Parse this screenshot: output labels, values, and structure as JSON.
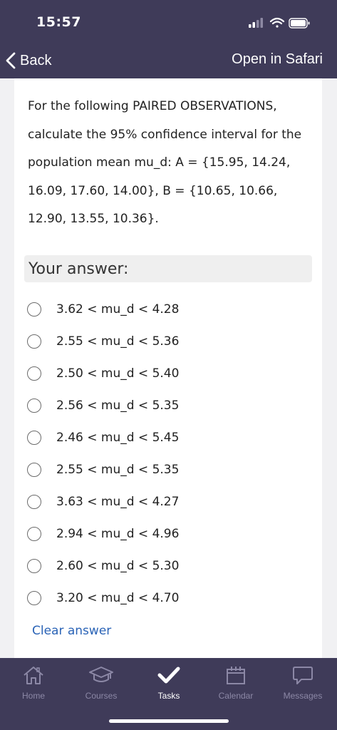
{
  "status_bar": {
    "time": "15:57"
  },
  "nav": {
    "back_label": "Back",
    "open_label": "Open in Safari"
  },
  "question": {
    "text": "For the following PAIRED OBSERVATIONS, calculate the 95% confidence interval for the population mean mu_d: A = {15.95, 14.24, 16.09, 17.60, 14.00}, B = {10.65, 10.66, 12.90, 13.55, 10.36}."
  },
  "answer_header": "Your answer:",
  "options": [
    "3.62 < mu_d < 4.28",
    "2.55 < mu_d < 5.36",
    "2.50 < mu_d < 5.40",
    "2.56 < mu_d < 5.35",
    "2.46 < mu_d < 5.45",
    "2.55 < mu_d < 5.35",
    "3.63 < mu_d < 4.27",
    "2.94 < mu_d < 4.96",
    "2.60 < mu_d < 5.30",
    "3.20 < mu_d < 4.70"
  ],
  "clear_label": "Clear answer",
  "tabs": [
    {
      "label": "Home",
      "icon": "home-icon"
    },
    {
      "label": "Courses",
      "icon": "graduation-cap-icon"
    },
    {
      "label": "Tasks",
      "icon": "checkmark-icon",
      "active": true
    },
    {
      "label": "Calendar",
      "icon": "calendar-icon"
    },
    {
      "label": "Messages",
      "icon": "message-bubble-icon"
    }
  ],
  "colors": {
    "brand": "#3f3b59",
    "link": "#2a63b6",
    "tab_inactive": "#8c88a6"
  }
}
